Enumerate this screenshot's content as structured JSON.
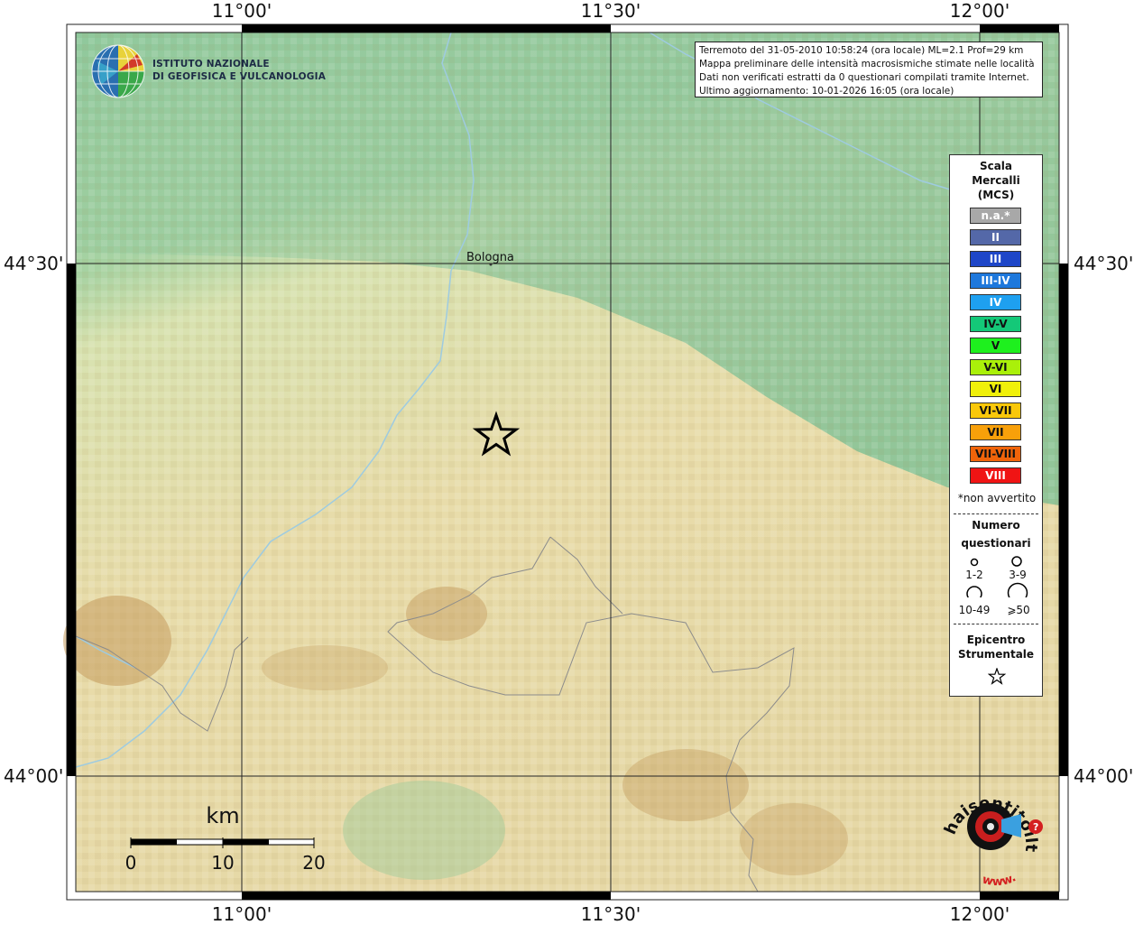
{
  "map": {
    "top_labels": [
      "11°00'",
      "11°30'",
      "12°00'"
    ],
    "bottom_labels": [
      "11°00'",
      "11°30'",
      "12°00'"
    ],
    "left_labels": [
      "44°30'",
      "44°00'"
    ],
    "right_labels": [
      "44°30'",
      "44°00'"
    ],
    "city_label": "Bologna"
  },
  "logo": {
    "line1": "ISTITUTO NAZIONALE",
    "line2": "DI GEOFISICA E VULCANOLOGIA"
  },
  "info": {
    "line1": "Terremoto del 31-05-2010 10:58:24 (ora locale) ML=2.1 Prof=29 km",
    "line2": "Mappa preliminare delle intensità macrosismiche stimate nelle località",
    "line3": "Dati non verificati estratti da 0 questionari compilati tramite Internet.",
    "line4": "Ultimo aggiornamento: 10-01-2026 16:05 (ora locale)"
  },
  "legend": {
    "title1": "Scala",
    "title2": "Mercalli",
    "title3": "(MCS)",
    "items": [
      {
        "label": "n.a.*",
        "color": "#a8a8a8",
        "text_color": "#ffffff"
      },
      {
        "label": "II",
        "color": "#5468a8",
        "text_color": "#ffffff"
      },
      {
        "label": "III",
        "color": "#1e46c8",
        "text_color": "#ffffff"
      },
      {
        "label": "III-IV",
        "color": "#1e78dc",
        "text_color": "#ffffff"
      },
      {
        "label": "IV",
        "color": "#1ea0f0",
        "text_color": "#ffffff"
      },
      {
        "label": "IV-V",
        "color": "#14c878",
        "text_color": "#111111"
      },
      {
        "label": "V",
        "color": "#1ef01e",
        "text_color": "#111111"
      },
      {
        "label": "V-VI",
        "color": "#aaf00a",
        "text_color": "#111111"
      },
      {
        "label": "VI",
        "color": "#f0f00a",
        "text_color": "#111111"
      },
      {
        "label": "VI-VII",
        "color": "#fac80a",
        "text_color": "#111111"
      },
      {
        "label": "VII",
        "color": "#f8a00a",
        "text_color": "#111111"
      },
      {
        "label": "VII-VIII",
        "color": "#f0640a",
        "text_color": "#111111"
      },
      {
        "label": "VIII",
        "color": "#f01414",
        "text_color": "#ffffff"
      }
    ],
    "not_felt": "*non avvertito",
    "questionnaires_title1": "Numero",
    "questionnaires_title2": "questionari",
    "q1": "1-2",
    "q2": "3-9",
    "q3": "10-49",
    "q4": "⩾50",
    "epicenter_title1": "Epicentro",
    "epicenter_title2": "Strumentale"
  },
  "scale": {
    "unit": "km",
    "labels": [
      "0",
      "10",
      "20"
    ]
  },
  "badge": {
    "text_main": "haisentitoilterremoto.it",
    "text_www": "www."
  }
}
